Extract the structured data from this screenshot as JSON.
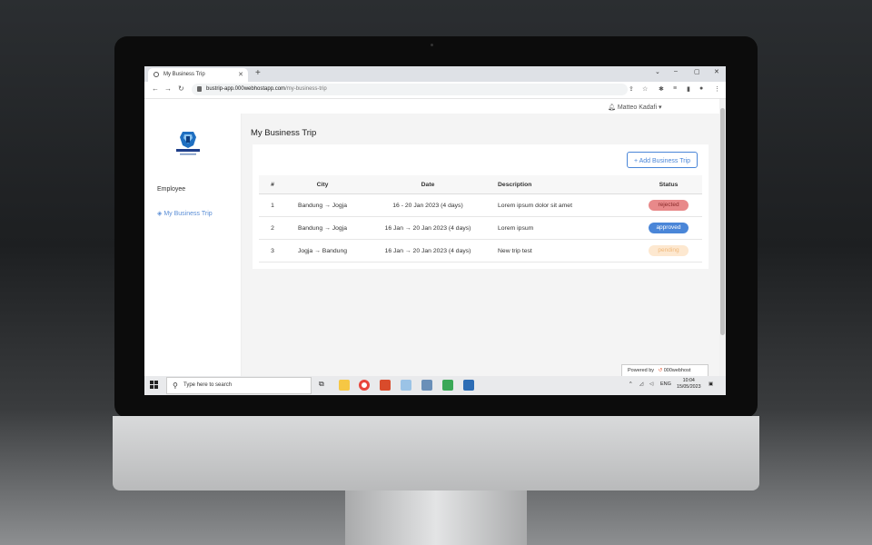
{
  "browser": {
    "tab_title": "My Business Trip",
    "new_tab": "+",
    "url_host": "bustrip-app.000webhostapp.com",
    "url_path": "/my-business-trip",
    "window_controls": {
      "collapse": "⌄",
      "minimize": "–",
      "restore": "▢",
      "close": "✕"
    }
  },
  "app": {
    "logo_text": "BUSINESS",
    "logo_sub": "TRIP APPLICATION",
    "user_name": "Matteo Kadafi",
    "sidebar": {
      "section": "Employee",
      "items": [
        {
          "label": "My Business Trip",
          "icon": "layers-icon"
        }
      ]
    },
    "page_title": "My Business Trip",
    "add_button": "+ Add Business Trip",
    "table": {
      "headers": [
        "#",
        "City",
        "Date",
        "Description",
        "Status"
      ],
      "rows": [
        {
          "no": "1",
          "city": "Bandung → Jogja",
          "date": "16 - 20 Jan 2023 (4 days)",
          "desc": "Lorem ipsum dolor sit amet",
          "status": "rejected"
        },
        {
          "no": "2",
          "city": "Bandung → Jogja",
          "date": "16 Jan → 20 Jan 2023 (4 days)",
          "desc": "Lorem ipsum",
          "status": "approved"
        },
        {
          "no": "3",
          "city": "Jogja → Bandung",
          "date": "16 Jan → 20 Jan 2023 (4 days)",
          "desc": "New trip test",
          "status": "pending"
        }
      ]
    },
    "status_colors": {
      "rejected": "#e8898a",
      "approved": "#4a86d8",
      "pending": "#fde8d0"
    },
    "powered_by": "Powered by",
    "powered_brand": "000webhost"
  },
  "taskbar": {
    "search_placeholder": "Type here to search",
    "lang": "ENG",
    "time": "10:04",
    "date": "15/05/2023"
  }
}
